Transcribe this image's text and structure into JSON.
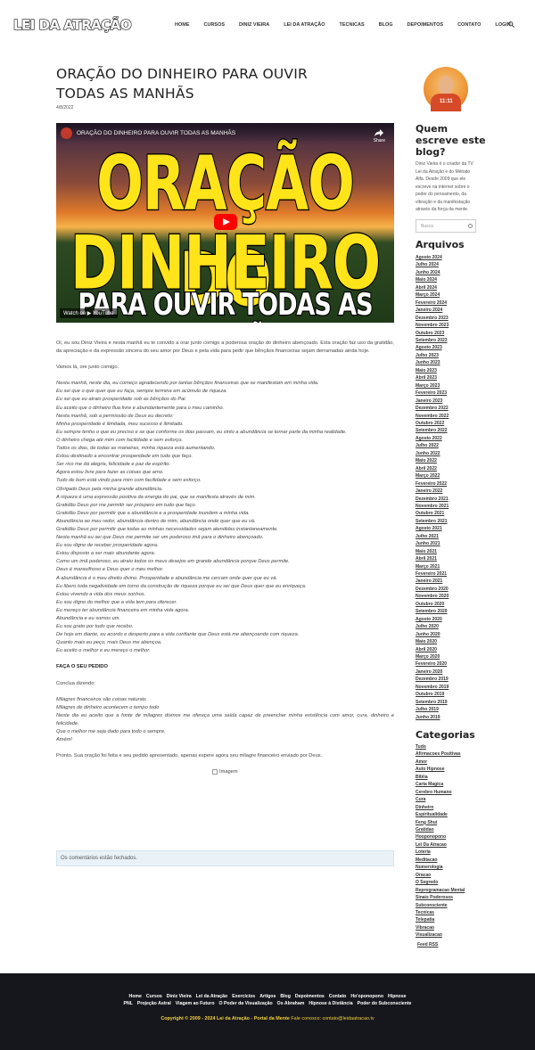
{
  "header": {
    "logo": "LEI DA ATRAÇÃO",
    "nav": [
      "HOME",
      "CURSOS",
      "DINIZ VIEIRA",
      "LEI DA ATRAÇÃO",
      "TECNICAS",
      "BLOG",
      "DEPOIMENTOS",
      "CONTATO",
      "LOGIN"
    ]
  },
  "post": {
    "title": "ORAÇÃO DO DINHEIRO PARA OUVIR TODAS AS MANHÃS",
    "date": "4/8/2022",
    "video": {
      "title": "ORAÇÃO DO DINHEIRO PARA OUVIR TODAS AS MANHÃS",
      "share": "Share",
      "watch": "Watch on  ▶ YouTube",
      "big1": "ORAÇÃO DO",
      "big2": "DINHEIRO",
      "big3": "PARA OUVIR TODAS AS MANHÃS"
    },
    "intro": "Oi, eu sou Diniz Vieira e nesta manhã eu te convido a orar junto comigo a poderosa oração do dinheiro abençoado. Esta oração faz uso da gratidão, da apreciação e da expressão sincera do seu amor por Deus e pela vida para pedir que bênçãos financeiras sejam derramadas ainda hoje.",
    "pray": "Vamos lá, ore junto comigo.",
    "prayer": [
      "Nesta manhã, neste dia, eu começo agradecendo por tantas bênçãos financeiras que se manifestam em minha vida.",
      "Eu sei que o que quer que eu faça, sempre termina em acúmulo de riqueza.",
      "Eu sei que eu atraio prosperidade sob as bênçãos do Pai.",
      "Eu aceito que o dinheiro flua livre e abundantemente para o meu caminho.",
      "Nesta manhã, sob a permissão de Deus eu decreto:",
      "Minha prosperidade é ilimitada, meu sucesso é ilimitado.",
      "Eu sempre tenho o que eu preciso e se que conforme os dias passam, eu sinto a abundância se tornar parte da minha realidade.",
      "O dinheiro chega até mim com facilidade e sem esforço.",
      "Todos os dias, de todas as maneiras, minha riqueza está aumentando.",
      "Estou destinado a encontrar prosperidade em tudo que faço.",
      "Ser rico me dá alegria, felicidade e paz de espírito.",
      "Agora estou livre para fazer as coisas que amo.",
      "Tudo de bom está vindo para mim com facilidade e sem esforço.",
      "Obrigado Deus pela minha grande abundância.",
      "A riqueza é uma expressão positiva da energia do pai, que se manifesta através de mim.",
      "Gratidão Deus por me permitir ser próspero em tudo que faço.",
      "Gratidão Deus por permitir que a abundância e a prosperidade inundem a minha vida.",
      "Abundância ao meu redor, abundância dentro de mim, abundância onde quer que eu vá.",
      "Gratidão Deus por permitir que todas as minhas necessidades sejam atendidas instantaneamente.",
      "Nesta manhã eu sei que Deus me permite ser um poderoso imã para o dinheiro abençoado.",
      "Eu sou digno de receber prosperidade agora.",
      "Estou disposto a ser mais abundante agora.",
      "Como um imã poderoso, eu atraio todos os meus desejos em grande abundância porque Deus permite.",
      "Deus é maravilhoso e Deus quer o meu melhor.",
      "A abundância é o meu direito divino. Prosperidade e abundância me cercam onde quer que eu vá.",
      "Eu libero toda negatividade em torno da construção de riqueza porque eu sei que Deus quer que eu enriqueça.",
      "Estou vivendo a vida dos meus sonhos.",
      "Eu sou digno do melhor que a vida tem para oferecer.",
      "Eu mereço ter abundância financeira em minha vida agora.",
      "Abundância e eu somos um.",
      "Eu sou grato por tudo que recebo.",
      "De hoje em diante, eu acordo e desperto para a vida confiante que Deus está me abençoando com riqueza.",
      "Quanto mais eu peço, mais Deus me abençoa.",
      "Eu aceito o melhor e eu mereço o melhor."
    ],
    "request_heading": "FAÇA O SEU PEDIDO",
    "conclude": "Conclua dizendo:",
    "final": [
      "Milagres financeiros são coisas naturais",
      "Milagres de dinheiro acontecem o tempo todo",
      "Neste dia eu aceito que a fonte de milagres divinos me ofereça uma saída capaz de preencher minha existência com amor, cura, dinheiro e felicidade.",
      "Que o melhor me seja dado para todo o sempre.",
      "Amém!"
    ],
    "ready": "Pronto. Sua oração foi feita e seu pedido apresentado, apenas espere agora seu milagre financeiro enviado por Deus.",
    "image_alt": "Imagem",
    "comments": "Os comentários estão fechados."
  },
  "sidebar": {
    "avatar_text": "11:11",
    "about_heading": "Quem escreve este blog?",
    "about": "Diniz Vieira é o criador da TV Lei da Atração e do Método Alfa. Desde 2009 que ele escreve na internet sobre o poder do pensamento, da vibração e da manifestação através da força da mente.",
    "search_placeholder": "Busca",
    "archives_heading": "Arquivos",
    "archives": [
      "Agosto 2024",
      "Julho 2024",
      "Junho 2024",
      "Maio 2024",
      "Abril 2024",
      "Março 2024",
      "Fevereiro 2024",
      "Janeiro 2024",
      "Dezembro 2023",
      "Novembro 2023",
      "Outubro 2023",
      "Setembro 2023",
      "Agosto 2023",
      "Julho 2023",
      "Junho 2023",
      "Maio 2023",
      "Abril 2023",
      "Março 2023",
      "Fevereiro 2023",
      "Janeiro 2023",
      "Dezembro 2022",
      "Novembro 2022",
      "Outubro 2022",
      "Setembro 2022",
      "Agosto 2022",
      "Julho 2022",
      "Junho 2022",
      "Maio 2022",
      "Abril 2022",
      "Março 2022",
      "Fevereiro 2022",
      "Janeiro 2022",
      "Dezembro 2021",
      "Novembro 2021",
      "Outubro 2021",
      "Setembro 2021",
      "Agosto 2021",
      "Julho 2021",
      "Junho 2021",
      "Maio 2021",
      "Abril 2021",
      "Março 2021",
      "Fevereiro 2021",
      "Janeiro 2021",
      "Dezembro 2020",
      "Novembro 2020",
      "Outubro 2020",
      "Setembro 2020",
      "Agosto 2020",
      "Julho 2020",
      "Junho 2020",
      "Maio 2020",
      "Abril 2020",
      "Março 2020",
      "Fevereiro 2020",
      "Janeiro 2020",
      "Dezembro 2019",
      "Novembro 2019",
      "Outubro 2019",
      "Setembro 2019",
      "Julho 2019",
      "Junho 2019"
    ],
    "categories_heading": "Categorias",
    "categories": [
      "Tudo",
      "Afirmacoes Positivas",
      "Amor",
      "Auto Hipnose",
      "Biblia",
      "Carta Magica",
      "Cerebro Humano",
      "Cura",
      "Dinheiro",
      "Espiritualidade",
      "Feng Shui",
      "Gratidao",
      "Hooponopono",
      "Lei Da Atracao",
      "Loteria",
      "Meditacao",
      "Numerologia",
      "Oracao",
      "O Segredo",
      "Reprogramacao Mental",
      "Sinais Poderosos",
      "Subconsciente",
      "Tecnicas",
      "Telepatia",
      "Vibracao",
      "Visualizacao"
    ],
    "feed": "Feed RSS"
  },
  "footer": {
    "row1": [
      "Home",
      "Cursos",
      "Diniz Vieira",
      "Lei da Atração",
      "Exercícios",
      "Artigos",
      "Blog",
      "Depoimentos",
      "Contato",
      "Ho'oponopono",
      "Hipnose"
    ],
    "row2": [
      "PNL",
      "Projeção Astral",
      "Viagem ao Futuro",
      "O Poder da Visualização",
      "Os Abraham",
      "Hipnose à Distância",
      "Poder do Subconsciente"
    ],
    "copyright": "Copyright © 2009 - 2024 Lei da Atração - Portal da Mente",
    "contact": "Fale conosco: contato@leidaatracao.tv"
  }
}
